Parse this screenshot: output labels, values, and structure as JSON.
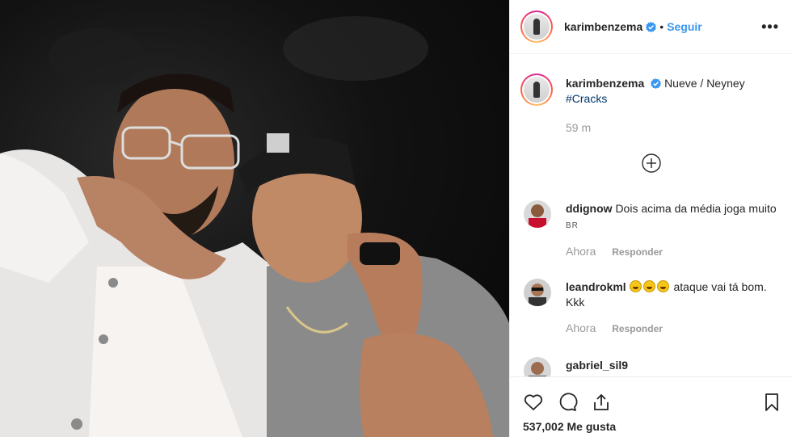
{
  "post": {
    "username": "karimbenzema",
    "separator": "•",
    "follow_label": "Seguir",
    "more_label": "•••"
  },
  "caption": {
    "username": "karimbenzema",
    "text": "Nueve / Neyney",
    "hashtag": "#Cracks",
    "time": "59 m"
  },
  "comments": [
    {
      "username": "ddignow",
      "text": "Dois acima da média joga muito",
      "suffix": "BR",
      "time": "Ahora",
      "reply_label": "Responder"
    },
    {
      "username": "leandrokml",
      "text": "ataque vai tá bom. Kkk",
      "emoji_count": 3,
      "time": "Ahora",
      "reply_label": "Responder"
    },
    {
      "username": "gabriel_sil9",
      "text": ""
    }
  ],
  "footer": {
    "likes": "537,002 Me gusta"
  },
  "colors": {
    "accent": "#3897f0",
    "hashtag": "#003569",
    "muted": "#999999"
  },
  "icons": [
    "verified-badge-icon",
    "more-options-icon",
    "load-more-comments-icon",
    "heart-icon",
    "comment-icon",
    "share-icon",
    "bookmark-icon"
  ]
}
